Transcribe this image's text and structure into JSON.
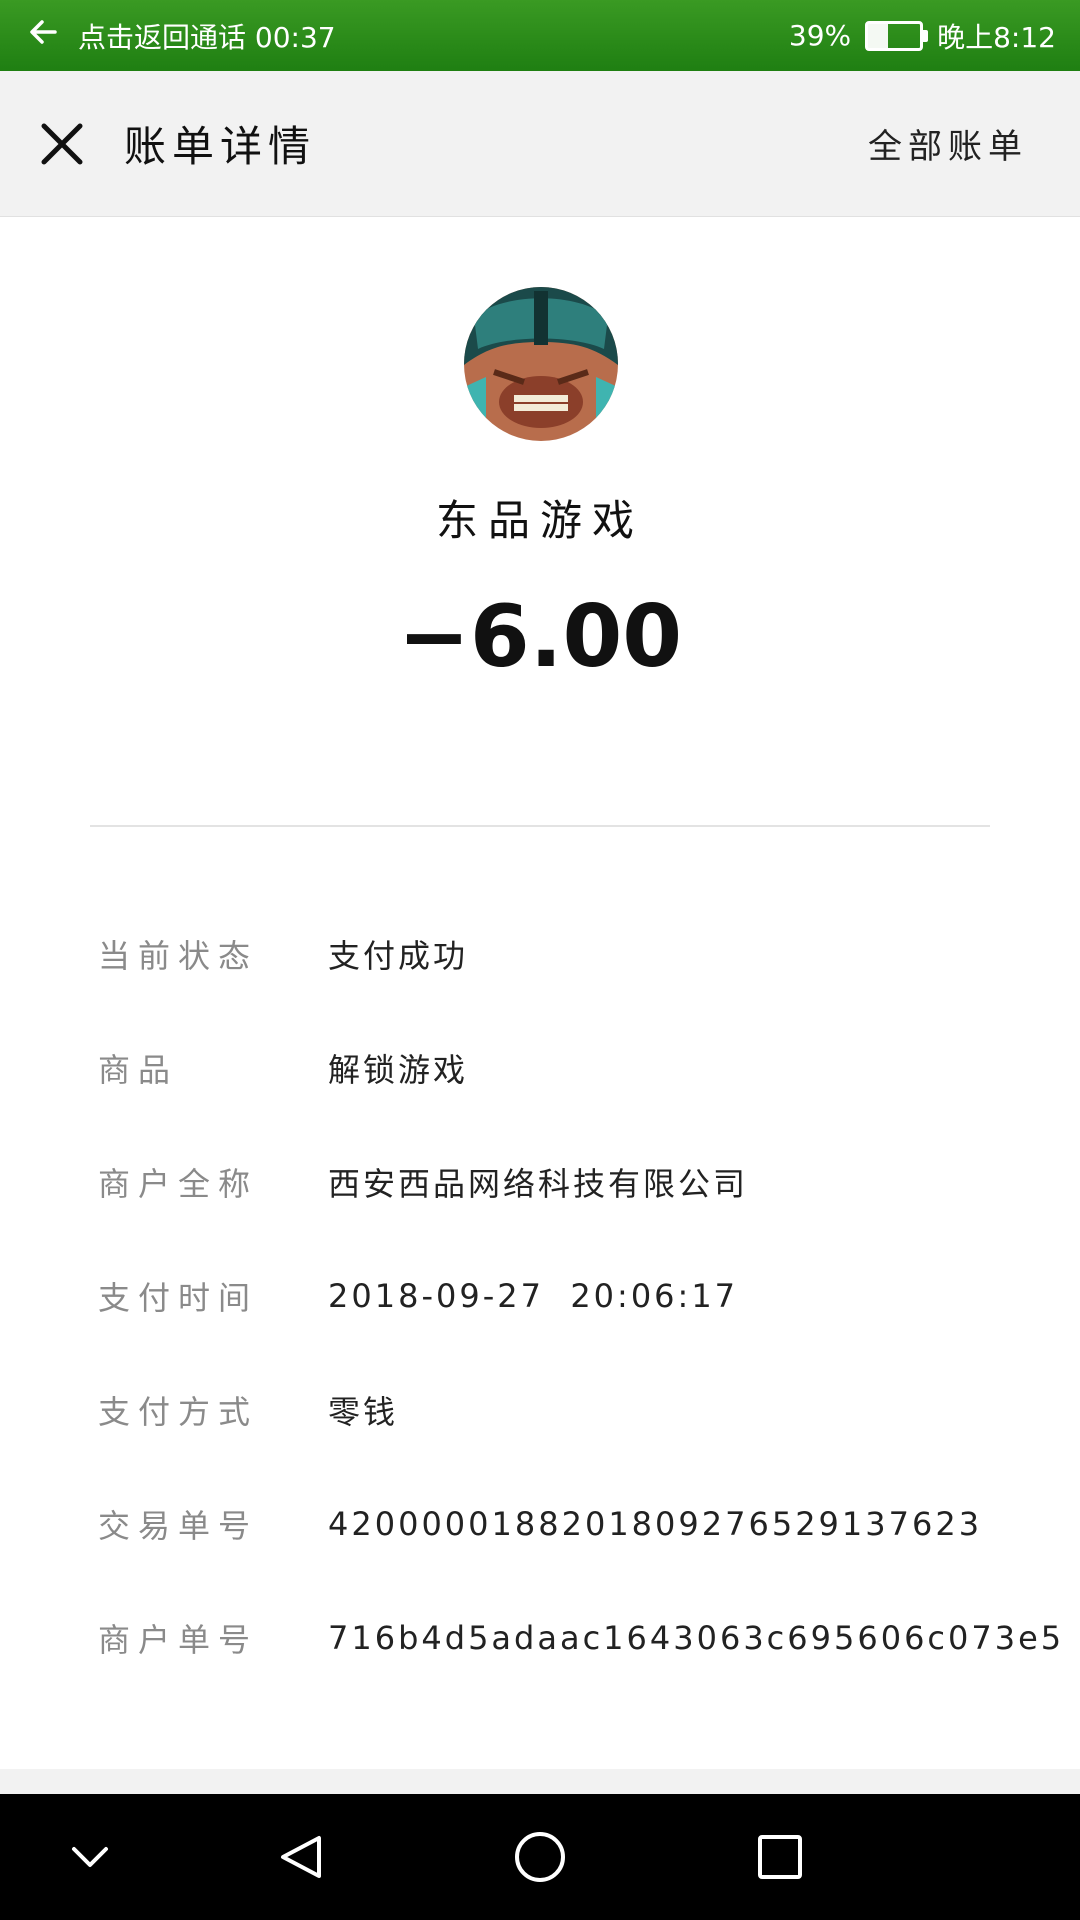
{
  "status_bar": {
    "call_text": "点击返回通话 00:37",
    "battery_percent": "39%",
    "battery_level": 0.39,
    "time": "晚上8:12"
  },
  "header": {
    "title": "账单详情",
    "all_bills_label": "全部账单"
  },
  "bill": {
    "merchant_name": "东品游戏",
    "amount": "−6.00"
  },
  "details": [
    {
      "label": "当前状态",
      "value": "支付成功"
    },
    {
      "label": "商品",
      "value": "解锁游戏"
    },
    {
      "label": "商户全称",
      "value": "西安西品网络科技有限公司"
    },
    {
      "label": "支付时间",
      "value": "2018-09-27  20:06:17"
    },
    {
      "label": "支付方式",
      "value": "零钱"
    },
    {
      "label": "交易单号",
      "value": "4200000188201809276529137623"
    },
    {
      "label": "商户单号",
      "value": "716b4d5adaac1643063c695606c073e5"
    }
  ],
  "nav_bar": {
    "icons": [
      "chevron-down-icon",
      "back-triangle-icon",
      "home-circle-icon",
      "recents-square-icon"
    ]
  }
}
